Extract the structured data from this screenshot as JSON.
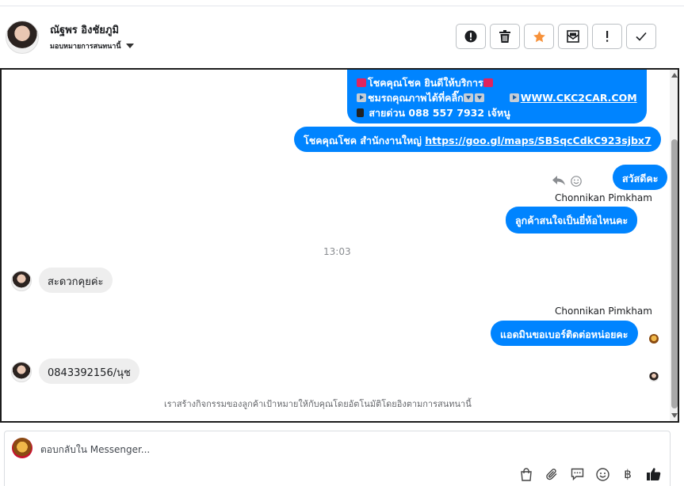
{
  "header": {
    "contact_name": "ณัฐพร อิงชัยภูมิ",
    "assign_label": "มอบหมายการสนทนานี้",
    "toolbar": [
      {
        "icon": "alert-circle-icon"
      },
      {
        "icon": "trash-icon"
      },
      {
        "icon": "star-icon"
      },
      {
        "icon": "envelope-icon"
      },
      {
        "icon": "exclamation-icon"
      },
      {
        "icon": "check-icon"
      }
    ]
  },
  "conversation": {
    "messages": [
      {
        "direction": "out",
        "line1": "โชคคุณโชค ยินดีให้บริการ",
        "line2": "ชมรถคุณภาพได้ที่คลิ๊ก",
        "line2_link": "WWW.CKC2CAR.COM",
        "line3": "สายด่วน 088 557 7932 เจ้หนู"
      },
      {
        "direction": "out",
        "text": "โชคคุณโชค สำนักงานใหญ่ ",
        "link": "https://goo.gl/maps/SBSqcCdkC923sjbx7"
      },
      {
        "direction": "out",
        "text": "สวัสดีคะ"
      },
      {
        "direction": "out",
        "sender": "Chonnikan Pimkham",
        "text": "ลูกค้าสนใจเป็นยี่ห้อไหนคะ"
      },
      {
        "direction": "in",
        "text": "สะดวกคุยค่ะ"
      },
      {
        "direction": "out",
        "sender": "Chonnikan Pimkham",
        "text": "แอดมินขอเบอร์ติดต่อหน่อยคะ"
      },
      {
        "direction": "in",
        "text": "0843392156/นุช"
      }
    ],
    "timestamp": "13:03",
    "notice": "เราสร้างกิจกรรมของลูกค้าเป้าหมายให้กับคุณโดยอัตโนมัติโดยอิงตามการสนทนานี้"
  },
  "composer": {
    "placeholder": "ตอบกลับใน Messenger...",
    "value": "",
    "currency_symbol": "฿",
    "tools": [
      "shopping-bag-icon",
      "paperclip-icon",
      "saved-replies-icon",
      "emoji-icon",
      "baht-icon",
      "thumbs-up-icon"
    ]
  },
  "colors": {
    "outgoing_bubble": "#0084ff",
    "incoming_bubble": "#eeeeee",
    "star": "#f7923b"
  }
}
